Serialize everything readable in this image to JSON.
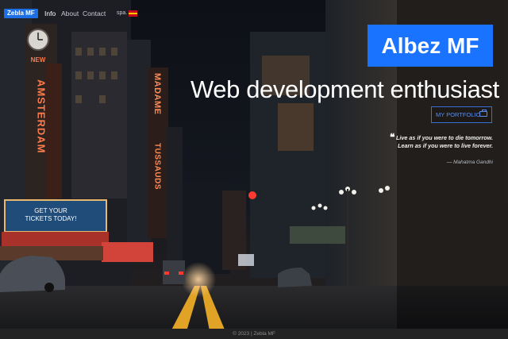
{
  "navbar": {
    "brand": "Zebla MF",
    "links": [
      "Info",
      "About",
      "Contact"
    ],
    "language": "spa.",
    "flag_colors": [
      "#c60b1e",
      "#ffc400",
      "#c60b1e"
    ]
  },
  "background": {
    "signs": {
      "amsterdam": "AMSTERDAM",
      "new": "NEW",
      "madame": "MADAME",
      "tussauds": "TUSSAUDS",
      "ticket_line1": "GET YOUR",
      "ticket_line2": "TICKETS TODAY!"
    },
    "colors": {
      "sky": "#0b0d12",
      "road": "#1b1d24",
      "neon": "#ff6a3d",
      "lane": "#e0a326"
    }
  },
  "hero": {
    "name": "Albez MF",
    "tagline": "Web development enthusiast",
    "portfolio_button": "MY PORTFOLIO",
    "quote_line1": "Live as if you were to die tomorrow.",
    "quote_line2": "Learn as if you were to live forever.",
    "quote_author": "— Mahatma Gandhi",
    "accent_color": "#1a73ff"
  },
  "footer": {
    "text": "© 2023 | Zebla MF"
  }
}
